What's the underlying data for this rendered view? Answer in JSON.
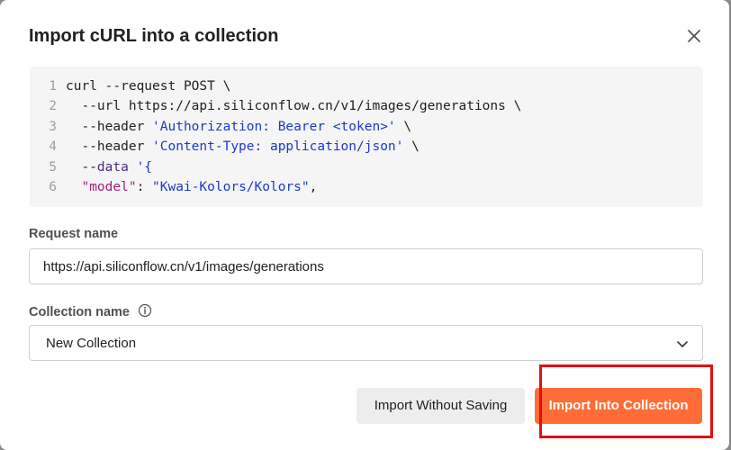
{
  "dialog": {
    "title": "Import cURL into a collection",
    "close_icon": "close-icon"
  },
  "code": {
    "lines": [
      {
        "num": "1",
        "parts": [
          {
            "t": "curl --request POST \\",
            "c": ""
          }
        ]
      },
      {
        "num": "2",
        "parts": [
          {
            "t": "  --url https://api.siliconflow.cn/v1/images/generations \\",
            "c": ""
          }
        ]
      },
      {
        "num": "3",
        "parts": [
          {
            "t": "  --header ",
            "c": ""
          },
          {
            "t": "'Authorization: Bearer <token>'",
            "c": "tok-str"
          },
          {
            "t": " \\",
            "c": ""
          }
        ]
      },
      {
        "num": "4",
        "parts": [
          {
            "t": "  --header ",
            "c": ""
          },
          {
            "t": "'Content-Type: application/json'",
            "c": "tok-str"
          },
          {
            "t": " \\",
            "c": ""
          }
        ]
      },
      {
        "num": "5",
        "parts": [
          {
            "t": "  --",
            "c": ""
          },
          {
            "t": "data",
            "c": "tok-kw"
          },
          {
            "t": " ",
            "c": ""
          },
          {
            "t": "'{",
            "c": "tok-str"
          }
        ]
      },
      {
        "num": "6",
        "parts": [
          {
            "t": "  ",
            "c": ""
          },
          {
            "t": "\"model\"",
            "c": "tok-key"
          },
          {
            "t": ": ",
            "c": ""
          },
          {
            "t": "\"Kwai-Kolors/Kolors\"",
            "c": "tok-str"
          },
          {
            "t": ",",
            "c": ""
          }
        ]
      }
    ]
  },
  "request_name": {
    "label": "Request name",
    "value": "https://api.siliconflow.cn/v1/images/generations"
  },
  "collection_name": {
    "label": "Collection name",
    "info_icon": "info-icon",
    "selected": "New Collection",
    "dropdown_icon": "chevron-down-icon"
  },
  "actions": {
    "secondary_label": "Import Without Saving",
    "primary_label": "Import Into Collection"
  },
  "colors": {
    "primary": "#ff6c37",
    "highlight": "#e01010",
    "string": "#1d38c8",
    "key": "#a11f7f"
  }
}
